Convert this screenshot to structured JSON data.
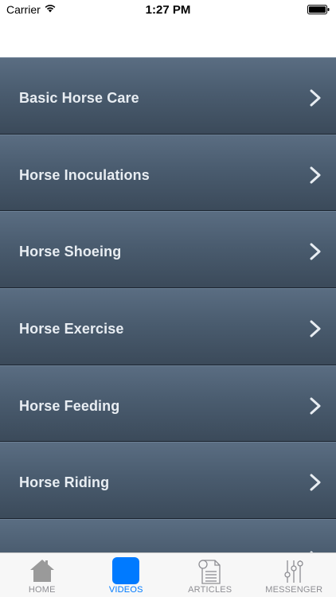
{
  "status_bar": {
    "carrier": "Carrier",
    "time": "1:27 PM"
  },
  "list": {
    "items": [
      {
        "label": "Basic Horse Care"
      },
      {
        "label": "Horse Inoculations"
      },
      {
        "label": "Horse Shoeing"
      },
      {
        "label": "Horse Exercise"
      },
      {
        "label": "Horse Feeding"
      },
      {
        "label": "Horse Riding"
      },
      {
        "label": ""
      }
    ]
  },
  "tab_bar": {
    "active_color": "#007aff",
    "inactive_color": "#8e8e93",
    "tabs": [
      {
        "label": "HOME",
        "icon": "home-icon",
        "active": false
      },
      {
        "label": "VIDEOS",
        "icon": "videos-icon",
        "active": true
      },
      {
        "label": "ARTICLES",
        "icon": "articles-icon",
        "active": false
      },
      {
        "label": "MESSENGER",
        "icon": "messenger-icon",
        "active": false
      }
    ]
  }
}
